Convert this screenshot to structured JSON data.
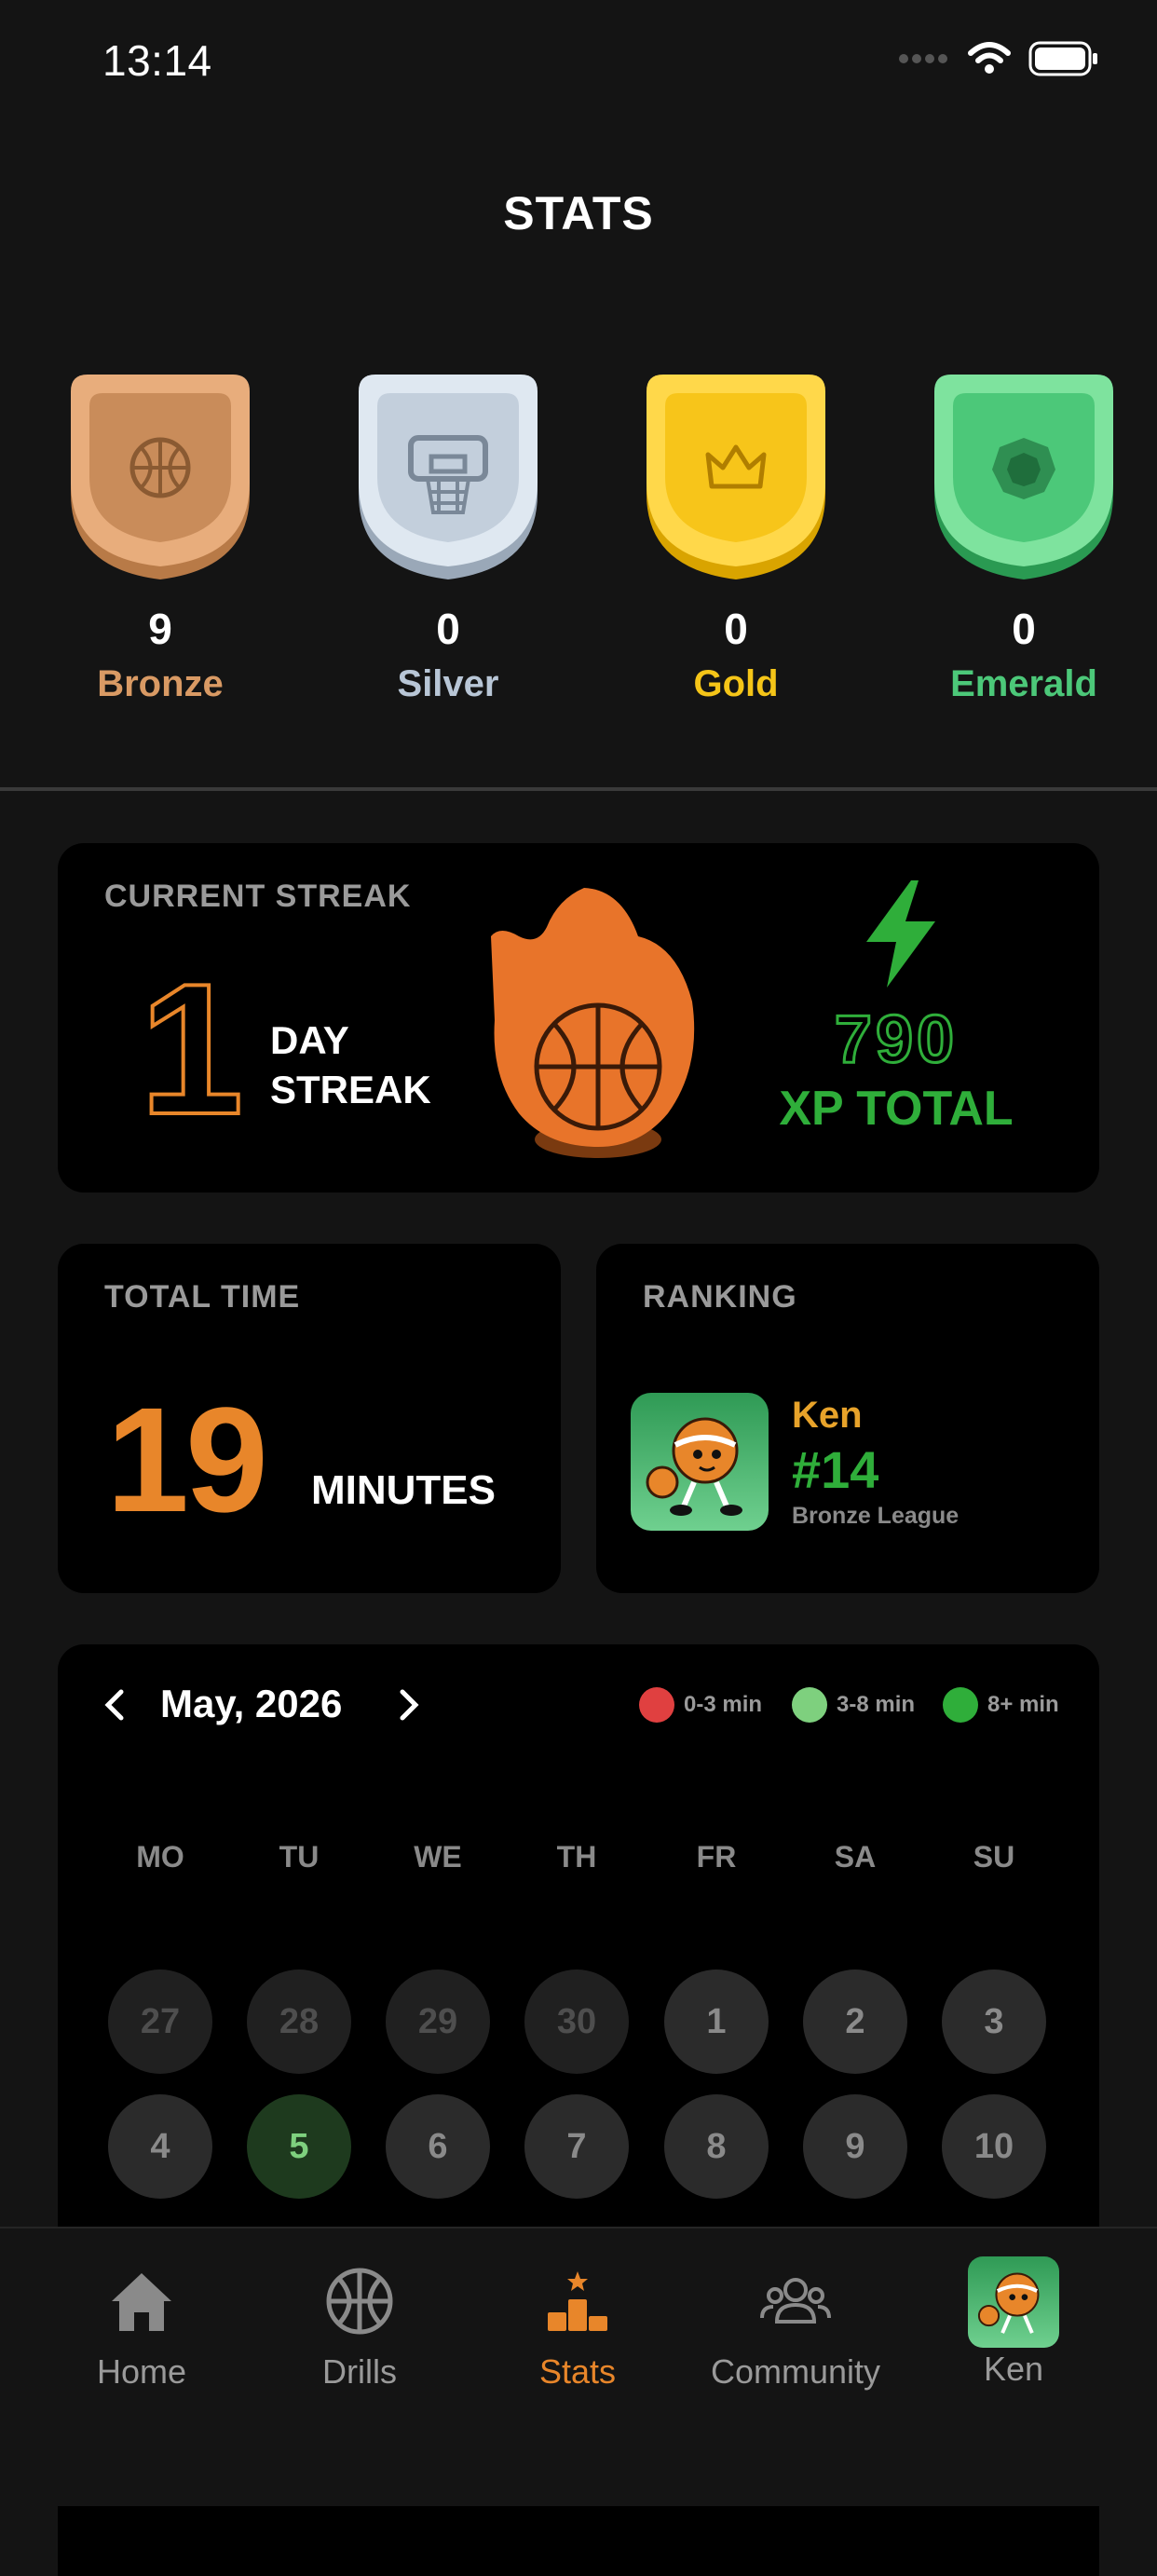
{
  "status": {
    "time": "13:14"
  },
  "page": {
    "title": "STATS"
  },
  "badges": [
    {
      "count": "9",
      "name": "Bronze",
      "color": "#d99a64"
    },
    {
      "count": "0",
      "name": "Silver",
      "color": "#b8c6d6"
    },
    {
      "count": "0",
      "name": "Gold",
      "color": "#f5c518"
    },
    {
      "count": "0",
      "name": "Emerald",
      "color": "#4cc879"
    }
  ],
  "streak": {
    "label": "CURRENT STREAK",
    "days": "1",
    "line1": "DAY",
    "line2": "STREAK",
    "xp_value": "790",
    "xp_label": "XP TOTAL"
  },
  "time": {
    "label": "TOTAL TIME",
    "value": "19",
    "unit": "MINUTES"
  },
  "ranking": {
    "label": "RANKING",
    "name": "Ken",
    "rank": "#14",
    "league": "Bronze League"
  },
  "calendar": {
    "month": "May, 2026",
    "legend": [
      {
        "label": "0-3 min",
        "color": "#e04040"
      },
      {
        "label": "3-8 min",
        "color": "#7ed07e"
      },
      {
        "label": "8+ min",
        "color": "#2fae3a"
      }
    ],
    "weekdays": [
      "MO",
      "TU",
      "WE",
      "TH",
      "FR",
      "SA",
      "SU"
    ],
    "row1": [
      "27",
      "28",
      "29",
      "30",
      "1",
      "2",
      "3"
    ],
    "row2": [
      "4",
      "5",
      "6",
      "7",
      "8",
      "9",
      "10"
    ]
  },
  "tabs": [
    {
      "label": "Home",
      "icon": "home-icon"
    },
    {
      "label": "Drills",
      "icon": "basketball-icon"
    },
    {
      "label": "Stats",
      "icon": "podium-icon"
    },
    {
      "label": "Community",
      "icon": "people-icon"
    },
    {
      "label": "Ken",
      "icon": "avatar"
    }
  ],
  "colors": {
    "accent": "#e8862a",
    "green": "#2fae3a",
    "card": "#000000",
    "background": "#141414"
  }
}
